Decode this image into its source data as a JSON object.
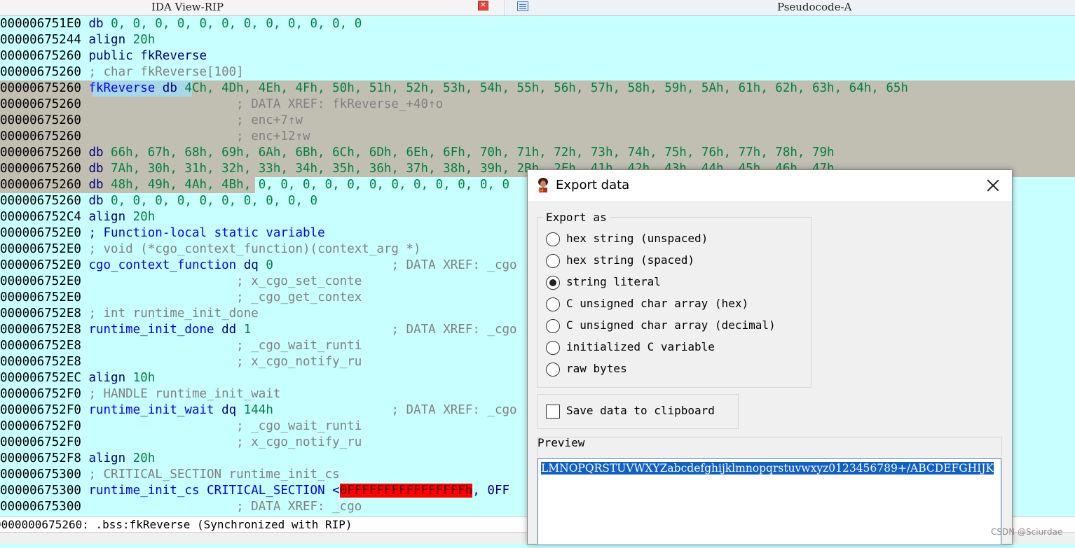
{
  "tabs": [
    {
      "label": "IDA View-RIP",
      "close_icon": "close-icon"
    },
    {
      "label": "Pseudocode-A",
      "icon": "pseudocode-icon"
    }
  ],
  "listing": [
    {
      "addr": "00000675 1E0",
      "parts": []
    }
  ],
  "lines": {
    "l0": {
      "addr": "00000675 1E0",
      "code": "db ",
      "vals": "0, 0, 0, 0, 0, 0, 0, 0, 0, 0, 0, 0"
    },
    "l1": {
      "addr": "0000067524 4",
      "code": "align ",
      "vals": "20h"
    },
    "l2": {
      "addr": "0000067526 0",
      "code": "public fkReverse"
    },
    "l3": {
      "addr": "0000067526 0",
      "code": "; char fkReverse[100]"
    },
    "l4": {
      "addr": "0000067526 0",
      "name": "fkReverse db ",
      "vals": "4Ch, 4Dh, 4Eh, 4Fh, 50h, 51h, 52h, 53h, 54h, 55h, 56h, 57h, 58h, 59h, 5Ah, 61h, 62h, 63h, 64h, 65h"
    },
    "l5": {
      "addr": "0000067526 0",
      "code": "                    ; DATA XREF: fkReverse_+40↑o"
    },
    "l6": {
      "addr": "0000067526 0",
      "code": "                    ; enc+7↑w"
    },
    "l7": {
      "addr": "0000067526 0",
      "code": "                    ; enc+12↑w"
    },
    "l8": {
      "addr": "0000067526 0",
      "code": "db ",
      "vals": "66h, 67h, 68h, 69h, 6Ah, 6Bh, 6Ch, 6Dh, 6Eh, 6Fh, 70h, 71h, 72h, 73h, 74h, 75h, 76h, 77h, 78h, 79h"
    },
    "l9": {
      "addr": "0000067526 0",
      "code": "db ",
      "vals": "7Ah, 30h, 31h, 32h, 33h, 34h, 35h, 36h, 37h, 38h, 39h, 2Bh, 2Fh, 41h, 42h, 43h, 44h, 45h, 46h, 47h"
    },
    "l10": {
      "addr": "0000067526 0",
      "code": "db ",
      "vals": "48h, 49h, 4Ah, 4Bh",
      "vals2": ", 0, 0, 0, 0, 0, 0, 0, 0, 0, 0, 0, 0"
    },
    "l11": {
      "addr": "0000067526 0",
      "code": "db ",
      "vals": "0, 0, 0, 0, 0, 0, 0, 0, 0, 0"
    },
    "l12": {
      "addr": "00000675 2C4",
      "code": "align ",
      "vals": "20h"
    },
    "l13": {
      "addr": "00000675 2E0",
      "code": "; Function-local static variable"
    },
    "l14": {
      "addr": "00000675 2E0",
      "code": "; void (*cgo_context_function)(context_arg *)"
    },
    "l15": {
      "addr": "00000675 2E0",
      "code": "cgo_context_function dq ",
      "vals": "0",
      "cmt": "                ; DATA XREF: _cgo"
    },
    "l16": {
      "addr": "00000675 2E0",
      "cmt": "                    ; x_cgo_set_conte"
    },
    "l17": {
      "addr": "00000675 2E0",
      "cmt": "                    ; _cgo_get_contex"
    },
    "l18": {
      "addr": "00000675 2E8",
      "code": "; int runtime_init_done"
    },
    "l19": {
      "addr": "00000675 2E8",
      "code": "runtime_init_done dd ",
      "vals": "1",
      "cmt": "                     ; DATA XREF: _cgo"
    },
    "l20": {
      "addr": "00000675 2E8",
      "cmt": "                    ; _cgo_wait_runti"
    },
    "l21": {
      "addr": "00000675 2E8",
      "cmt": "                    ; x_cgo_notify_ru"
    },
    "l22": {
      "addr": "00000675 2EC",
      "code": "align ",
      "vals": "10h"
    },
    "l23": {
      "addr": "00000675 2F0",
      "code": "; HANDLE runtime_init_wait"
    },
    "l24": {
      "addr": "00000675 2F0",
      "code": "runtime_init_wait dq ",
      "vals": "144h",
      "cmt": "                  ; DATA XREF: _cgo"
    },
    "l25": {
      "addr": "00000675 2F0",
      "cmt": "                    ; _cgo_wait_runti"
    },
    "l26": {
      "addr": "00000675 2F0",
      "cmt": "                    ; x_cgo_notify_ru"
    },
    "l27": {
      "addr": "00000675 2F8",
      "code": "align ",
      "vals": "20h"
    },
    "l28": {
      "addr": "0000067530 0",
      "code": "; CRITICAL_SECTION runtime_init_cs"
    },
    "l29": {
      "addr": "0000067530 0",
      "code": "runtime_init_cs CRITICAL_SECTION <",
      "red": "0FFFFFFFFFFFFFFFFh",
      "after": ", 0FF"
    },
    "l30": {
      "addr": "0000067530 0",
      "cmt": "                    ; DATA XREF: _cgo"
    }
  },
  "status": {
    "text": "0000000675260: .bss:fkReverse (Synchronized with RIP)"
  },
  "dialog": {
    "title": "Export data",
    "export_as_label": "Export as",
    "options": [
      "hex string (unspaced)",
      "hex string (spaced)",
      "string literal",
      "C unsigned char array (hex)",
      "C unsigned char array (decimal)",
      "initialized C variable",
      "raw bytes"
    ],
    "selected_index": 2,
    "clipboard_label": "Save data to clipboard",
    "clipboard_checked": false,
    "preview_label": "Preview",
    "preview_text": "LMNOPQRSTUVWXYZabcdefghijklmnopqrstuvwxyz0123456789+/ABCDEFGHIJK"
  },
  "watermark": "CSDN @Sciurdae",
  "colors": {
    "background": "#c8ffff",
    "highlight": "#c0bfb2",
    "instruction": "#000080",
    "number": "#008040",
    "comment": "#808080",
    "selection": "#1060c8",
    "red_value": "#ff0000"
  }
}
